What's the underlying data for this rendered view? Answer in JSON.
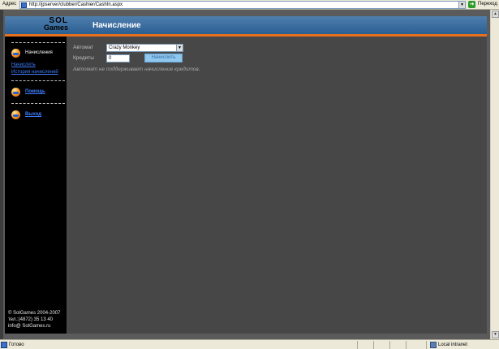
{
  "browser": {
    "address_label": "Адрес",
    "url": "http://jpserver/clubber/Cashier/CashIn.aspx",
    "go_label": "Переход",
    "status_text": "Готово",
    "zone_text": "Local intranet"
  },
  "header": {
    "logo_top": "SOL",
    "logo_bottom": "Games",
    "title": "Начисление"
  },
  "sidebar": {
    "section_label": "Начисления",
    "sub_links": [
      "Начислить",
      "История начислений"
    ],
    "help_label": "Помощь",
    "exit_label": "Выход",
    "footer": [
      "© SolGames 2004-2007",
      "тел.:(4872) 35 13 40",
      "info@ SolGames.ru"
    ]
  },
  "form": {
    "machine_label": "Автомат",
    "machine_value": "Crazy Monkey",
    "credits_label": "Кредиты",
    "credits_value": "0",
    "submit_label": "Начислить",
    "notice": "Автомат не поддерживает начисление кредитов."
  },
  "icons": {
    "nav": "coin-stack-icon",
    "page": "ie-page-icon",
    "go": "go-arrow-icon",
    "zone": "intranet-zone-icon"
  }
}
